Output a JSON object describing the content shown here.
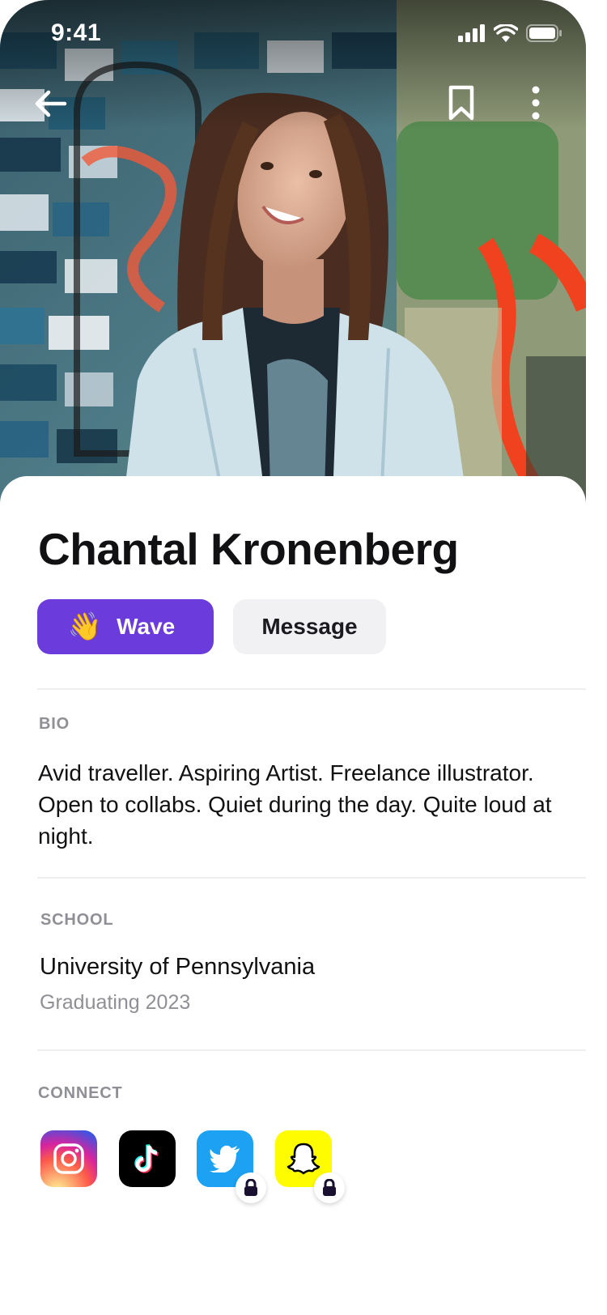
{
  "status_bar": {
    "time": "9:41"
  },
  "profile": {
    "name": "Chantal Kronenberg",
    "wave_label": "Wave",
    "wave_emoji": "👋",
    "message_label": "Message"
  },
  "bio": {
    "label": "BIO",
    "text": "Avid traveller. Aspiring Artist. Freelance illustrator. Open to collabs. Quiet during the day. Quite loud at night."
  },
  "school": {
    "label": "SCHOOL",
    "name": "University of Pennsylvania",
    "graduation": "Graduating 2023"
  },
  "connect": {
    "label": "CONNECT",
    "links": [
      {
        "icon": "instagram-icon",
        "locked": false
      },
      {
        "icon": "tiktok-icon",
        "locked": false
      },
      {
        "icon": "twitter-icon",
        "locked": true,
        "color": "#1DA1F2"
      },
      {
        "icon": "snapchat-icon",
        "locked": true,
        "color": "#FFFC00"
      }
    ]
  },
  "colors": {
    "accent": "#6B3BDB",
    "secondary_button": "#F1F1F4",
    "muted_text": "#8F8F96"
  }
}
